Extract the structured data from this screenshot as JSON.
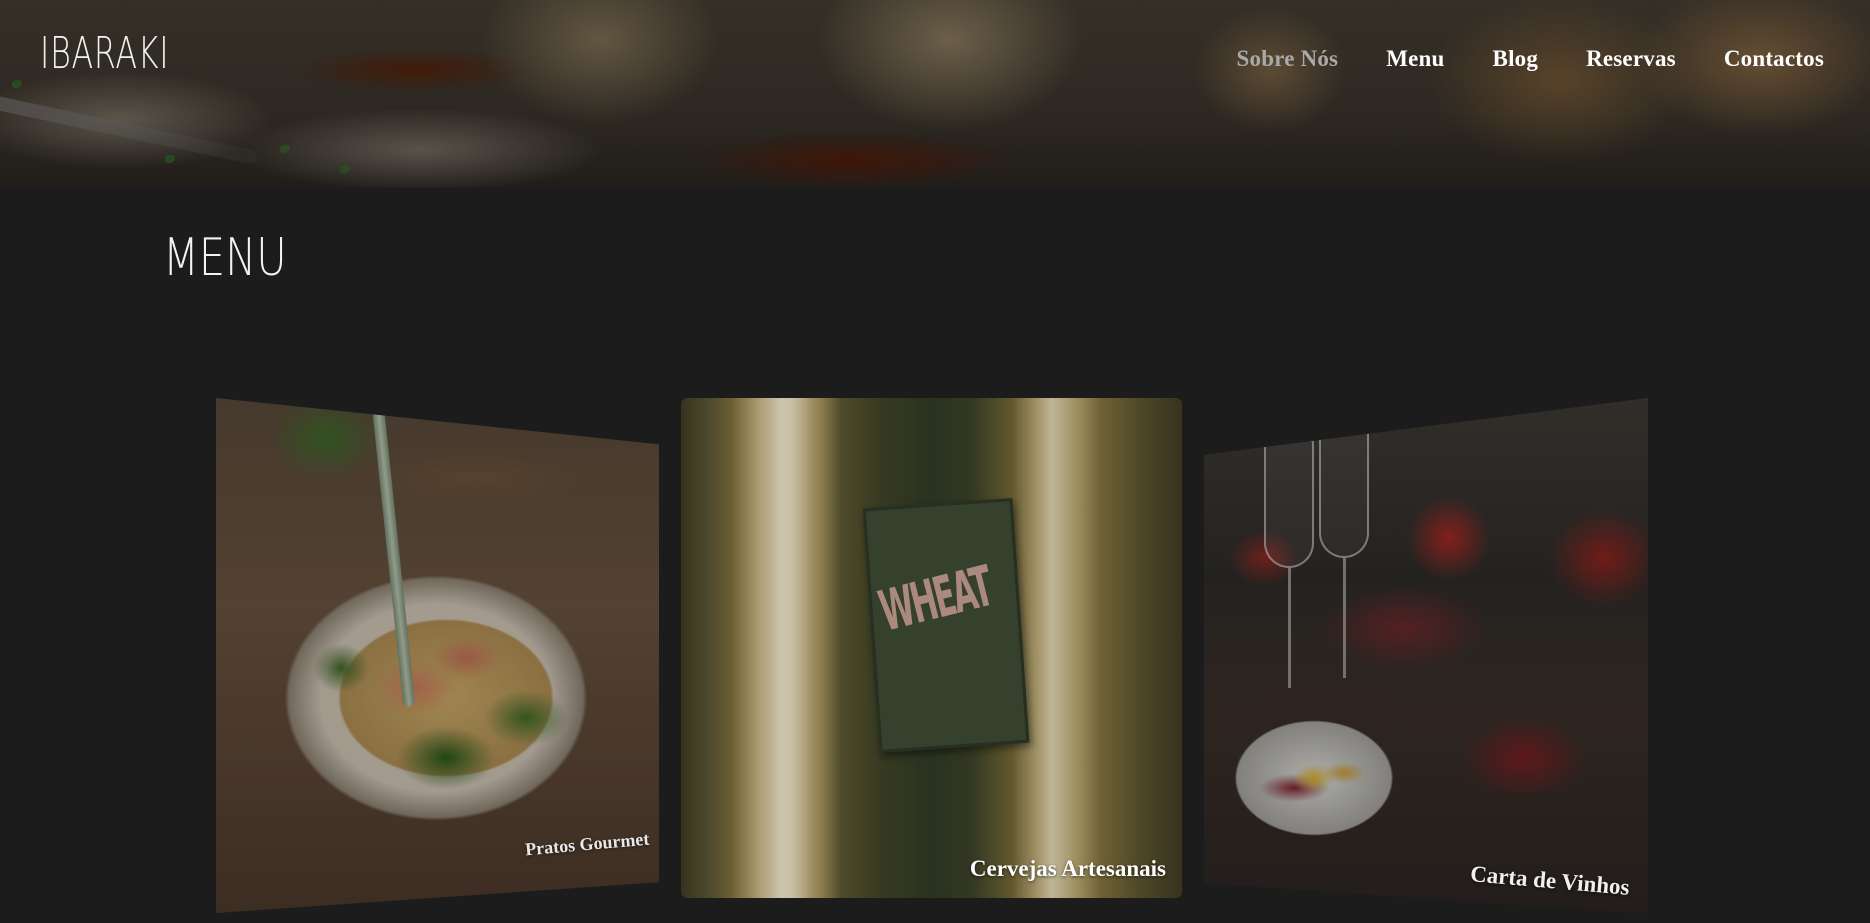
{
  "brand": {
    "logo_text": "IBARAKI"
  },
  "nav": {
    "items": [
      {
        "label": "Sobre Nós",
        "active": true
      },
      {
        "label": "Menu",
        "active": false
      },
      {
        "label": "Blog",
        "active": false
      },
      {
        "label": "Reservas",
        "active": false
      },
      {
        "label": "Contactos",
        "active": false
      }
    ]
  },
  "menu_section": {
    "title": "MENU",
    "cards": [
      {
        "label": "Pratos Gourmet",
        "image": "pasta-dish-image"
      },
      {
        "label": "Cervejas Artesanais",
        "image": "wheat-beer-tap-image"
      },
      {
        "label": "Carta de Vinhos",
        "image": "wine-table-setting-image"
      }
    ]
  },
  "colors": {
    "background": "#1c1c1c",
    "text": "#ffffff",
    "nav_active": "#a9a9a9"
  }
}
